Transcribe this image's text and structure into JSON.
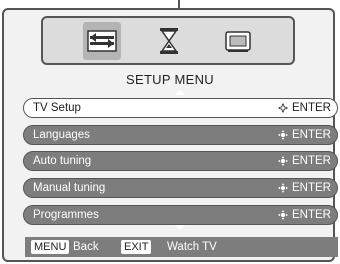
{
  "menu": {
    "title": "SETUP MENU",
    "top_icons": [
      {
        "name": "setup-icon",
        "active": true
      },
      {
        "name": "timer-icon",
        "active": false
      },
      {
        "name": "picture-icon",
        "active": false
      }
    ],
    "items": [
      {
        "label": "TV Setup",
        "action": "ENTER",
        "selected": true
      },
      {
        "label": "Languages",
        "action": "ENTER",
        "selected": false
      },
      {
        "label": "Auto tuning",
        "action": "ENTER",
        "selected": false
      },
      {
        "label": "Manual tuning",
        "action": "ENTER",
        "selected": false
      },
      {
        "label": "Programmes",
        "action": "ENTER",
        "selected": false
      }
    ]
  },
  "footer": {
    "menu_key": "MENU",
    "menu_text": "Back",
    "exit_key": "EXIT",
    "exit_text": "Watch TV"
  },
  "colors": {
    "frame_border": "#555555",
    "row_background": "#7d7d7d",
    "selected_row_background": "#ffffff",
    "active_icon_background": "#b4b4b4"
  }
}
